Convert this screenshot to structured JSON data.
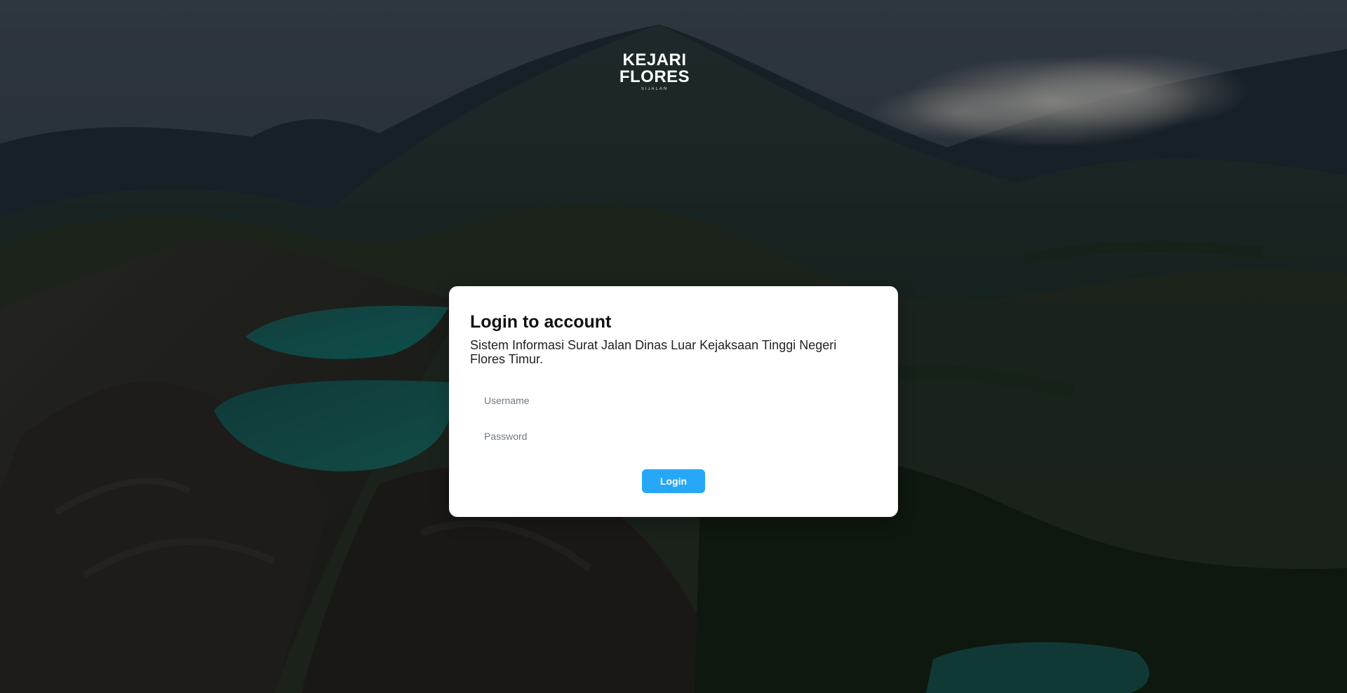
{
  "logo": {
    "title": "KEJARI FLORES",
    "subtitle": "SIJALAN"
  },
  "login": {
    "title": "Login to account",
    "subtitle": "Sistem Informasi Surat Jalan Dinas Luar Kejaksaan Tinggi Negeri Flores Timur.",
    "username_placeholder": "Username",
    "password_placeholder": "Password",
    "button_label": "Login"
  },
  "colors": {
    "primary": "#27a7f8",
    "card": "#ffffff",
    "overlay": "#000000",
    "lake": "#1d6f6f"
  }
}
